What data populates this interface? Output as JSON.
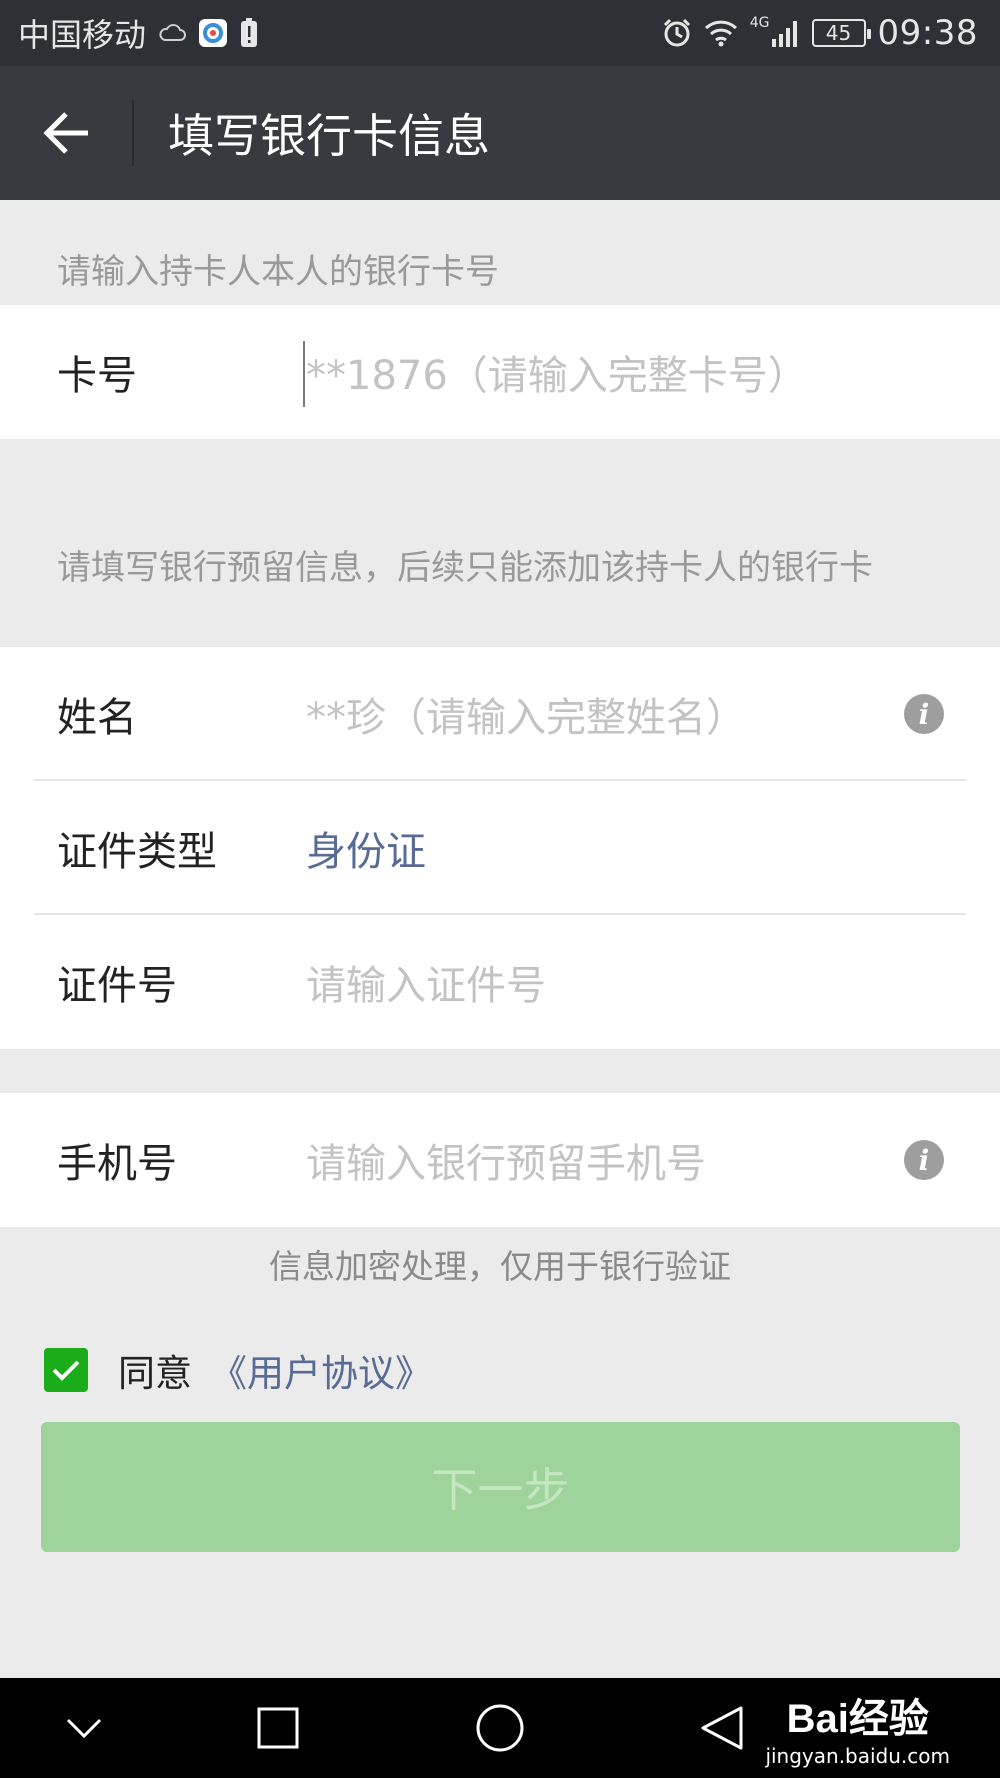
{
  "status_bar": {
    "carrier": "中国移动",
    "network": "4G",
    "battery": "45",
    "time": "09:38"
  },
  "header": {
    "title": "填写银行卡信息"
  },
  "card_section": {
    "hint": "请输入持卡人本人的银行卡号",
    "card_label": "卡号",
    "card_placeholder": "**1876（请输入完整卡号）"
  },
  "info_section": {
    "hint": "请填写银行预留信息，后续只能添加该持卡人的银行卡",
    "name_label": "姓名",
    "name_placeholder": "**珍（请输入完整姓名）",
    "id_type_label": "证件类型",
    "id_type_value": "身份证",
    "id_number_label": "证件号",
    "id_number_placeholder": "请输入证件号"
  },
  "phone_section": {
    "phone_label": "手机号",
    "phone_placeholder": "请输入银行预留手机号"
  },
  "encryption_note": "信息加密处理，仅用于银行验证",
  "agreement": {
    "checked": true,
    "text": "同意",
    "link": "《用户协议》"
  },
  "next_button": "下一步",
  "watermark": {
    "logo": "Bai经验",
    "url": "jingyan.baidu.com"
  },
  "colors": {
    "accent_green": "#1aad19",
    "link_blue": "#576b95",
    "header_bg": "#393a3f"
  }
}
